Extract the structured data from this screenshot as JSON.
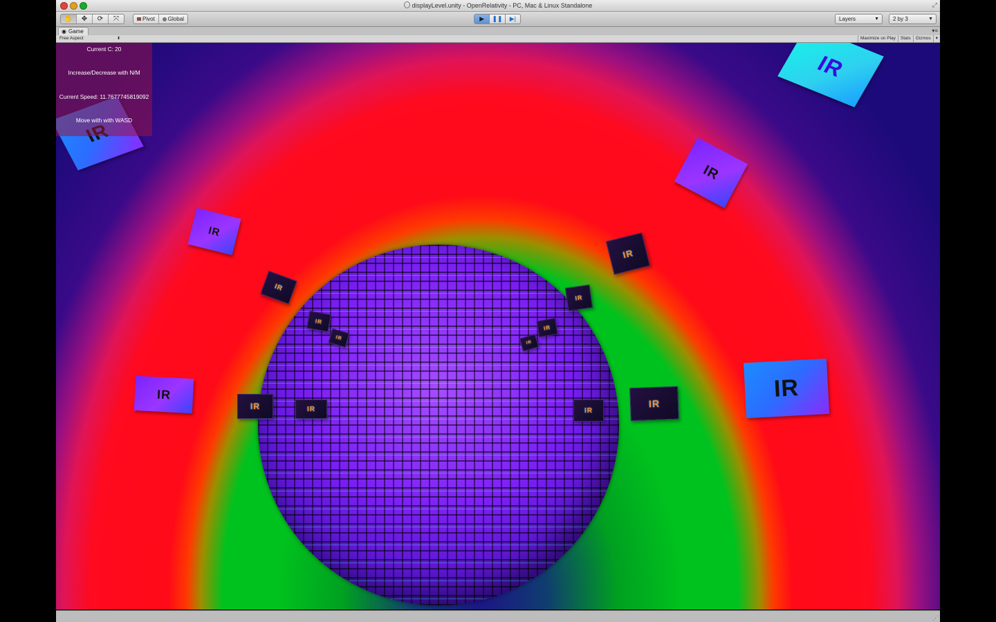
{
  "window": {
    "title": "displayLevel.unity - OpenRelativity - PC, Mac & Linux Standalone"
  },
  "toolbar": {
    "tools": [
      {
        "name": "hand-tool",
        "glyph": "✋"
      },
      {
        "name": "move-tool",
        "glyph": "✥"
      },
      {
        "name": "rotate-tool",
        "glyph": "⟳"
      },
      {
        "name": "scale-tool",
        "glyph": "⤧"
      }
    ],
    "pivot_label": "Pivot",
    "global_label": "Global",
    "play_glyph": "▶",
    "pause_glyph": "❚❚",
    "step_glyph": "▶|",
    "layers_label": "Layers",
    "layout_label": "2 by 3"
  },
  "tab": {
    "label": "Game",
    "menu_glyph": "▾≡"
  },
  "game_bar": {
    "aspect_label": "Free Aspect",
    "maximize_label": "Maximize on Play",
    "stats_label": "Stats",
    "gizmos_label": "Gizmos"
  },
  "hud": {
    "current_c": "Current C: 20",
    "controls_hint": "Increase/Decrease with N/M",
    "current_speed": "Current Speed: 11.7677745819092",
    "move_hint": "Move with with WASD"
  },
  "scene": {
    "cube_label": "IR"
  }
}
